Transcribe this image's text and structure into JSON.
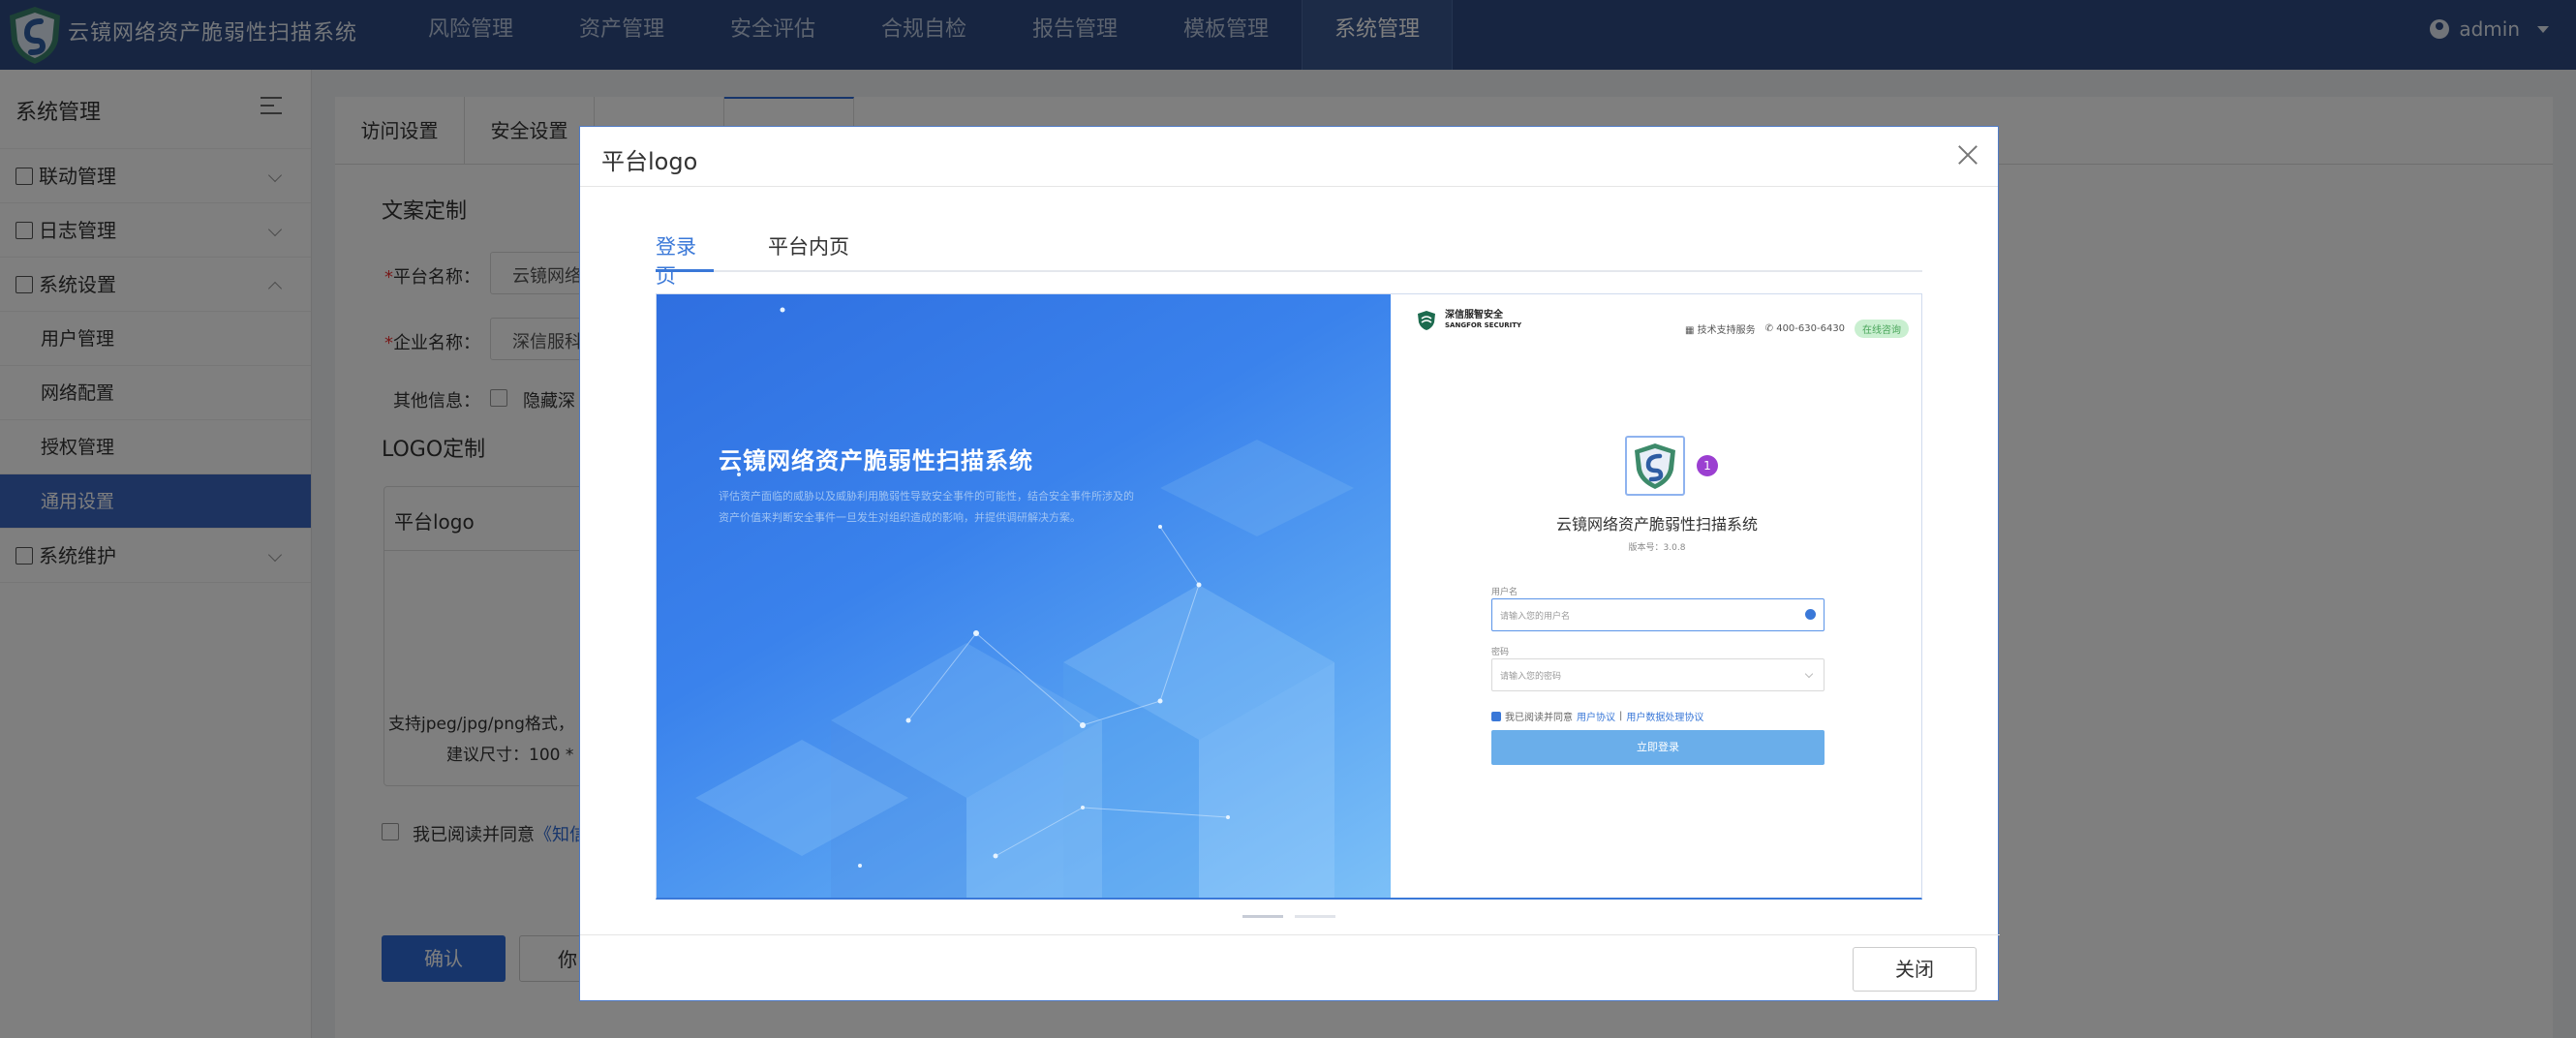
{
  "app": {
    "title": "云镜网络资产脆弱性扫描系统",
    "user": "admin"
  },
  "nav": [
    {
      "label": "风险管理"
    },
    {
      "label": "资产管理"
    },
    {
      "label": "安全评估"
    },
    {
      "label": "合规自检"
    },
    {
      "label": "报告管理"
    },
    {
      "label": "模板管理"
    },
    {
      "label": "系统管理",
      "active": true
    }
  ],
  "sidebar": {
    "title": "系统管理",
    "items": [
      {
        "label": "联动管理"
      },
      {
        "label": "日志管理"
      },
      {
        "label": "系统设置"
      },
      {
        "label": "用户管理"
      },
      {
        "label": "网络配置"
      },
      {
        "label": "授权管理"
      },
      {
        "label": "通用设置",
        "active": true
      },
      {
        "label": "系统维护"
      }
    ]
  },
  "main": {
    "tabs": [
      "访问设置",
      "安全设置"
    ],
    "copy_title": "文案定制",
    "platform_name_label": "平台名称：",
    "platform_name_value": "云镜网络",
    "company_name_label": "企业名称：",
    "company_name_value": "深信服科",
    "other_info_label": "其他信息：",
    "hide_label": "隐藏深",
    "logo_title": "LOGO定制",
    "logo_card_title": "平台logo",
    "logo_hint_1": "支持jpeg/jpg/png格式，",
    "logo_hint_2": "建议尺寸：100 * 1",
    "agree_text": "我已阅读并同意",
    "agree_link": "《知信",
    "confirm_button": "确认",
    "other_button": "你"
  },
  "modal": {
    "title": "平台logo",
    "tabs": [
      {
        "label": "登录页",
        "active": true
      },
      {
        "label": "平台内页"
      }
    ],
    "close_button": "关闭",
    "preview": {
      "left_title": "云镜网络资产脆弱性扫描系统",
      "left_desc": "评估资产面临的威胁以及威胁利用脆弱性导致安全事件的可能性，结合安全事件所涉及的资产价值来判断安全事件一旦发生对组织造成的影响，并提供调研解决方案。",
      "brand_cn": "深信服智安全",
      "brand_en": "SANGFOR SECURITY",
      "support_label": "技术支持服务",
      "phone": "400-630-6430",
      "online_label": "在线咨询",
      "badge": "1",
      "system_name": "云镜网络资产脆弱性扫描系统",
      "version": "版本号：3.0.8",
      "username_label": "用户名",
      "username_placeholder": "请输入您的用户名",
      "password_label": "密码",
      "password_placeholder": "请输入您的密码",
      "agree_prefix": "我已阅读并同意",
      "agree_link1": "用户协议",
      "agree_sep": "|",
      "agree_link2": "用户数据处理协议",
      "login_button": "立即登录"
    }
  },
  "colors": {
    "topbar": "#2e4b82",
    "accent": "#2e6bd6",
    "sidebar_active": "#3b67c0",
    "badge": "#9b3fd1"
  }
}
